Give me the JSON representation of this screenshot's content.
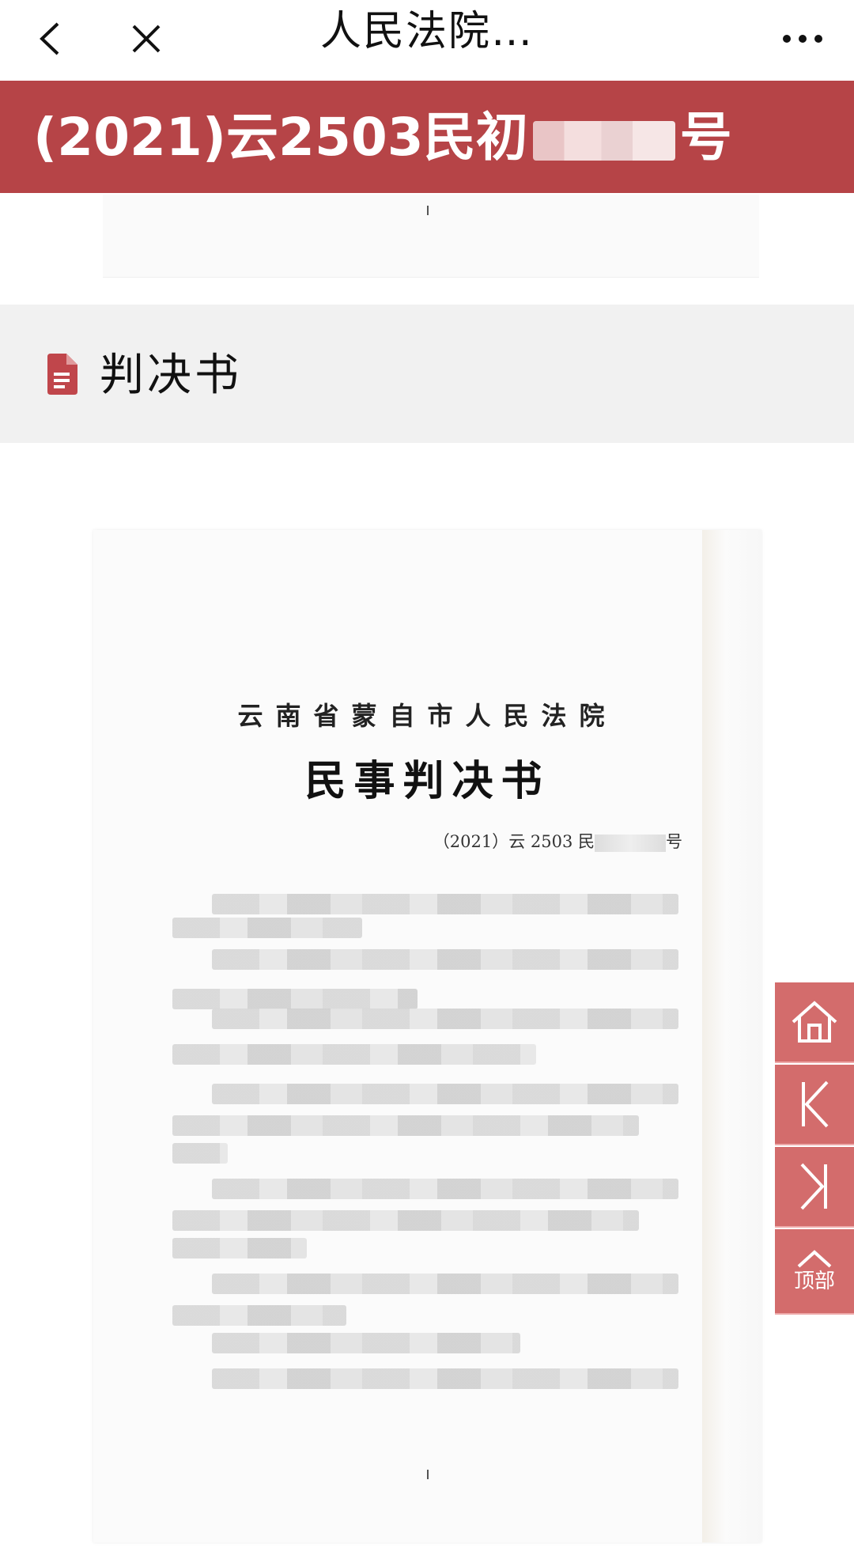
{
  "nav": {
    "title": "人民法院…",
    "back_icon": "chevron-left-icon",
    "close_icon": "close-icon",
    "more_icon": "more-dots-icon"
  },
  "case": {
    "number_prefix": "(2021)云2503民初",
    "number_suffix": "号"
  },
  "doc_type": {
    "label": "判决书",
    "icon": "document-icon"
  },
  "document": {
    "court_name": "云南省蒙自市人民法院",
    "title": "民事判决书",
    "number_prefix": "（2021）云 2503 民",
    "number_suffix": "号"
  },
  "side_buttons": {
    "home_icon": "home-icon",
    "prev_icon": "prev-page-icon",
    "next_icon": "next-page-icon",
    "top_label": "顶部"
  },
  "colors": {
    "banner": "#b64447",
    "side_button": "#d36c6c",
    "doc_icon": "#c0464b"
  }
}
